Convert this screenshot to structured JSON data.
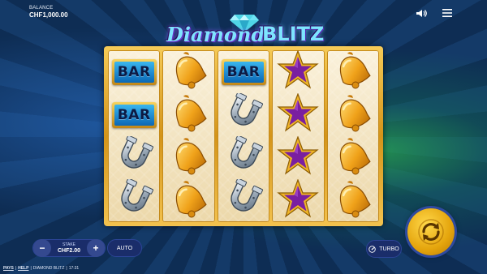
{
  "balance": {
    "label": "BALANCE",
    "value": "CHF1,000.00"
  },
  "header": {
    "sound_icon": "speaker-icon",
    "menu_icon": "hamburger-menu-icon"
  },
  "logo": {
    "word1": "Diamond",
    "word2": "BLITZ"
  },
  "reels": [
    [
      "BAR",
      "BAR",
      "horseshoe",
      "horseshoe"
    ],
    [
      "bell",
      "bell",
      "bell",
      "bell"
    ],
    [
      "BAR",
      "horseshoe",
      "horseshoe",
      "horseshoe"
    ],
    [
      "star",
      "star",
      "star",
      "star"
    ],
    [
      "bell",
      "bell",
      "bell",
      "bell"
    ]
  ],
  "controls": {
    "minus": "−",
    "plus": "+",
    "stake_label": "STAKE",
    "stake_value": "CHF2.00",
    "auto": "AUTO",
    "turbo": "TURBO"
  },
  "colors": {
    "accent": "#f2b21a",
    "panel": "#1a2d6a",
    "star": "#7a1fa0"
  },
  "footer": {
    "pays": "PAYS",
    "help": "HELP",
    "sep": "|",
    "game": "DIAMOND BLITZ",
    "time": "17:31"
  }
}
